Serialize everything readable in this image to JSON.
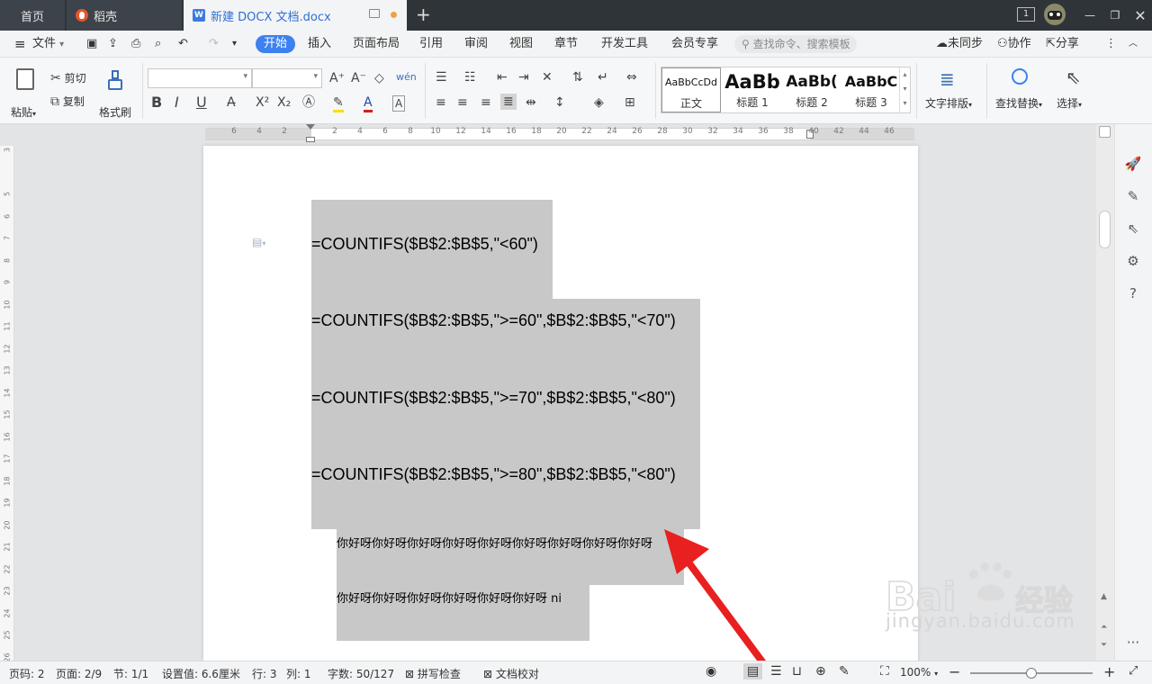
{
  "tabs": {
    "home": "首页",
    "daoke": "稻壳",
    "document": "新建 DOCX 文档.docx",
    "add": "+"
  },
  "window": {
    "page_indicator": "1"
  },
  "menu": {
    "file": "文件",
    "items": [
      "开始",
      "插入",
      "页面布局",
      "引用",
      "审阅",
      "视图",
      "章节",
      "开发工具",
      "会员专享"
    ],
    "search_placeholder": "查找命令、搜索模板",
    "sync": "未同步",
    "collab": "协作",
    "share": "分享"
  },
  "ribbon": {
    "paste": "粘贴",
    "cut": "剪切",
    "copy": "复制",
    "format_painter": "格式刷",
    "bold": "B",
    "italic": "I",
    "underline": "U",
    "styles": [
      {
        "preview": "AaBbCcDd",
        "name": "正文"
      },
      {
        "preview": "AaBb",
        "name": "标题 1"
      },
      {
        "preview": "AaBb(",
        "name": "标题 2"
      },
      {
        "preview": "AaBbC",
        "name": "标题 3"
      }
    ],
    "text_layout": "文字排版",
    "find_replace": "查找替换",
    "select": "选择"
  },
  "ruler": {
    "numbers": [
      "6",
      "4",
      "2",
      "",
      "2",
      "4",
      "6",
      "8",
      "10",
      "12",
      "14",
      "16",
      "18",
      "20",
      "22",
      "24",
      "26",
      "28",
      "30",
      "32",
      "34",
      "36",
      "38",
      "40",
      "42",
      "44",
      "46"
    ],
    "vertical": [
      "3",
      "",
      "5",
      "6",
      "7",
      "8",
      "9",
      "10",
      "11",
      "12",
      "13",
      "14",
      "15",
      "16",
      "17",
      "18",
      "19",
      "20",
      "21",
      "22",
      "23",
      "24",
      "25",
      "26"
    ]
  },
  "document": {
    "formulas": [
      "=COUNTIFS($B$2:$B$5,\"<60\")",
      "=COUNTIFS($B$2:$B$5,\">=60\",$B$2:$B$5,\"<70\")",
      "=COUNTIFS($B$2:$B$5,\">=70\",$B$2:$B$5,\"<80\")",
      "=COUNTIFS($B$2:$B$5,\">=80\",$B$2:$B$5,\"<80\")"
    ],
    "chinese_line1": "你好呀你好呀你好呀你好呀你好呀你好呀你好呀你好呀你好呀",
    "chinese_line2": "你好呀你好呀你好呀你好呀你好呀你好呀 ni"
  },
  "status": {
    "page_num": "页码: 2",
    "pages": "页面: 2/9",
    "section": "节: 1/1",
    "setting": "设置值: 6.6厘米",
    "row": "行: 3",
    "col": "列: 1",
    "word_count": "字数: 50/127",
    "spell_check": "拼写检查",
    "doc_proof": "文档校对",
    "zoom": "100%"
  },
  "watermark": {
    "brand": "Bai du 经验",
    "url": "jingyan.baidu.com"
  },
  "colors": {
    "accent": "#3d80f0",
    "highlight": "#c8c8c8",
    "arrow": "#e8201f"
  }
}
